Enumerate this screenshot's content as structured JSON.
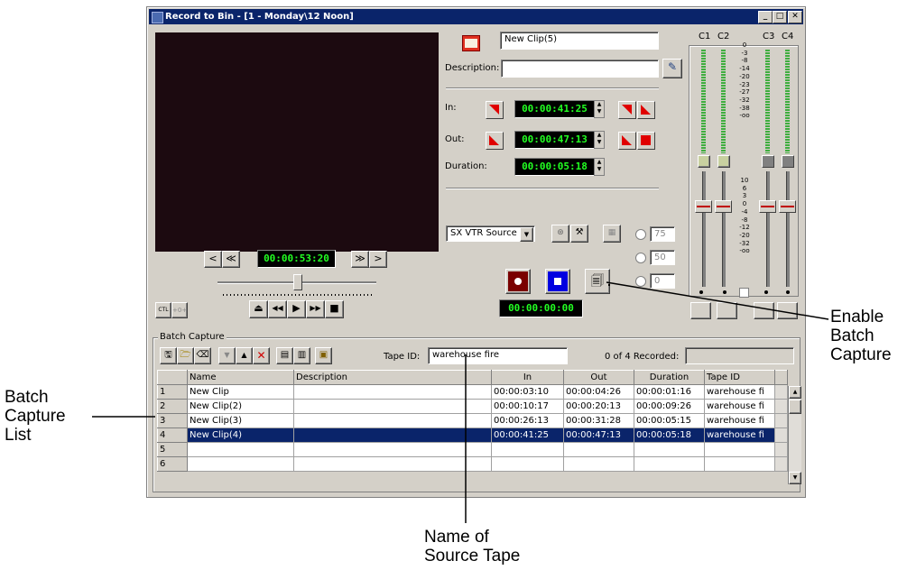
{
  "window": {
    "title": "Record to Bin - [1 - Monday\\12 Noon]",
    "minimize_label": "_",
    "maximize_label": "□",
    "close_label": "✕"
  },
  "transport": {
    "timecode": "00:00:53:20",
    "step_back_label": "<",
    "rewind_fast_label": "≪",
    "forward_fast_label": "≫",
    "step_forward_label": ">",
    "ctl_label": "CTL",
    "eject_label": "⏏",
    "rewind_label": "◀◀",
    "play_label": "▶",
    "ffwd_label": "▶▶",
    "stop_label": "■"
  },
  "clip": {
    "name": "New Clip(5)",
    "description_label": "Description:",
    "description_value": "",
    "in_label": "In:",
    "in_time": "00:00:41:25",
    "out_label": "Out:",
    "out_time": "00:00:47:13",
    "duration_label": "Duration:",
    "duration_time": "00:00:05:18"
  },
  "source": {
    "selected": "SX VTR Source",
    "radio_75": "75",
    "radio_50": "50",
    "radio_0": "0"
  },
  "record": {
    "timecode": "00:00:00:00"
  },
  "audio": {
    "channels": [
      "C1",
      "C2",
      "C3",
      "C4"
    ],
    "meter_scale": [
      "0",
      "-3",
      "-8",
      "-14",
      "-20",
      "-23",
      "-27",
      "-32",
      "-38",
      "-oo"
    ],
    "fader_scale": [
      "10",
      "6",
      "3",
      "0",
      "-4",
      "-8",
      "-12",
      "-20",
      "-32",
      "-oo"
    ]
  },
  "batch": {
    "group_label": "Batch Capture",
    "tape_id_label": "Tape ID:",
    "tape_id_value": "warehouse fire",
    "recorded_status": "0 of 4 Recorded:",
    "columns": [
      "",
      "Name",
      "Description",
      "In",
      "Out",
      "Duration",
      "Tape ID"
    ],
    "rows": [
      {
        "num": "1",
        "name": "New Clip",
        "description": "",
        "in": "00:00:03:10",
        "out": "00:00:04:26",
        "duration": "00:00:01:16",
        "tape": "warehouse fi"
      },
      {
        "num": "2",
        "name": "New Clip(2)",
        "description": "",
        "in": "00:00:10:17",
        "out": "00:00:20:13",
        "duration": "00:00:09:26",
        "tape": "warehouse fi"
      },
      {
        "num": "3",
        "name": "New Clip(3)",
        "description": "",
        "in": "00:00:26:13",
        "out": "00:00:31:28",
        "duration": "00:00:05:15",
        "tape": "warehouse fi"
      },
      {
        "num": "4",
        "name": "New Clip(4)",
        "description": "",
        "in": "00:00:41:25",
        "out": "00:00:47:13",
        "duration": "00:00:05:18",
        "tape": "warehouse fi"
      },
      {
        "num": "5",
        "name": "",
        "description": "",
        "in": "",
        "out": "",
        "duration": "",
        "tape": ""
      },
      {
        "num": "6",
        "name": "",
        "description": "",
        "in": "",
        "out": "",
        "duration": "",
        "tape": ""
      }
    ],
    "selected_row": 3
  },
  "annotations": {
    "enable_batch": [
      "Enable",
      "Batch",
      "Capture"
    ],
    "batch_list": [
      "Batch",
      "Capture",
      "List"
    ],
    "source_tape": [
      "Name of",
      "Source Tape"
    ]
  }
}
